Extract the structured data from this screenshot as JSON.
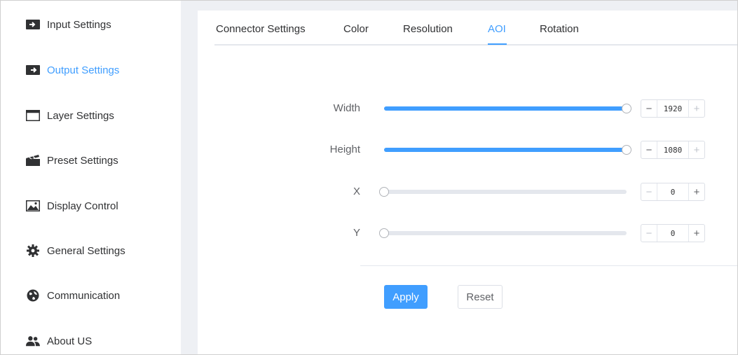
{
  "sidebar": {
    "items": [
      {
        "label": "Input Settings",
        "icon": "input-icon"
      },
      {
        "label": "Output Settings",
        "icon": "output-icon",
        "active": true
      },
      {
        "label": "Layer Settings",
        "icon": "window-icon"
      },
      {
        "label": "Preset Settings",
        "icon": "clapperboard-icon"
      },
      {
        "label": "Display Control",
        "icon": "image-icon"
      },
      {
        "label": "General Settings",
        "icon": "gear-icon"
      },
      {
        "label": "Communication",
        "icon": "globe-icon"
      },
      {
        "label": "About US",
        "icon": "users-icon"
      }
    ]
  },
  "tabs": [
    {
      "label": "Connector Settings"
    },
    {
      "label": "Color"
    },
    {
      "label": "Resolution"
    },
    {
      "label": "AOI",
      "active": true
    },
    {
      "label": "Rotation"
    }
  ],
  "aoi": {
    "width": {
      "label": "Width",
      "value": "1920",
      "level": 1.0
    },
    "height": {
      "label": "Height",
      "value": "1080",
      "level": 1.0
    },
    "x": {
      "label": "X",
      "value": "0",
      "level": 0.0
    },
    "y": {
      "label": "Y",
      "value": "0",
      "level": 0.0
    }
  },
  "stepper": {
    "minus": "−",
    "plus": "+"
  },
  "actions": {
    "apply": "Apply",
    "reset": "Reset"
  },
  "colors": {
    "accent": "#409eff",
    "track": "#e4e7ed",
    "background": "#eef0f4"
  }
}
